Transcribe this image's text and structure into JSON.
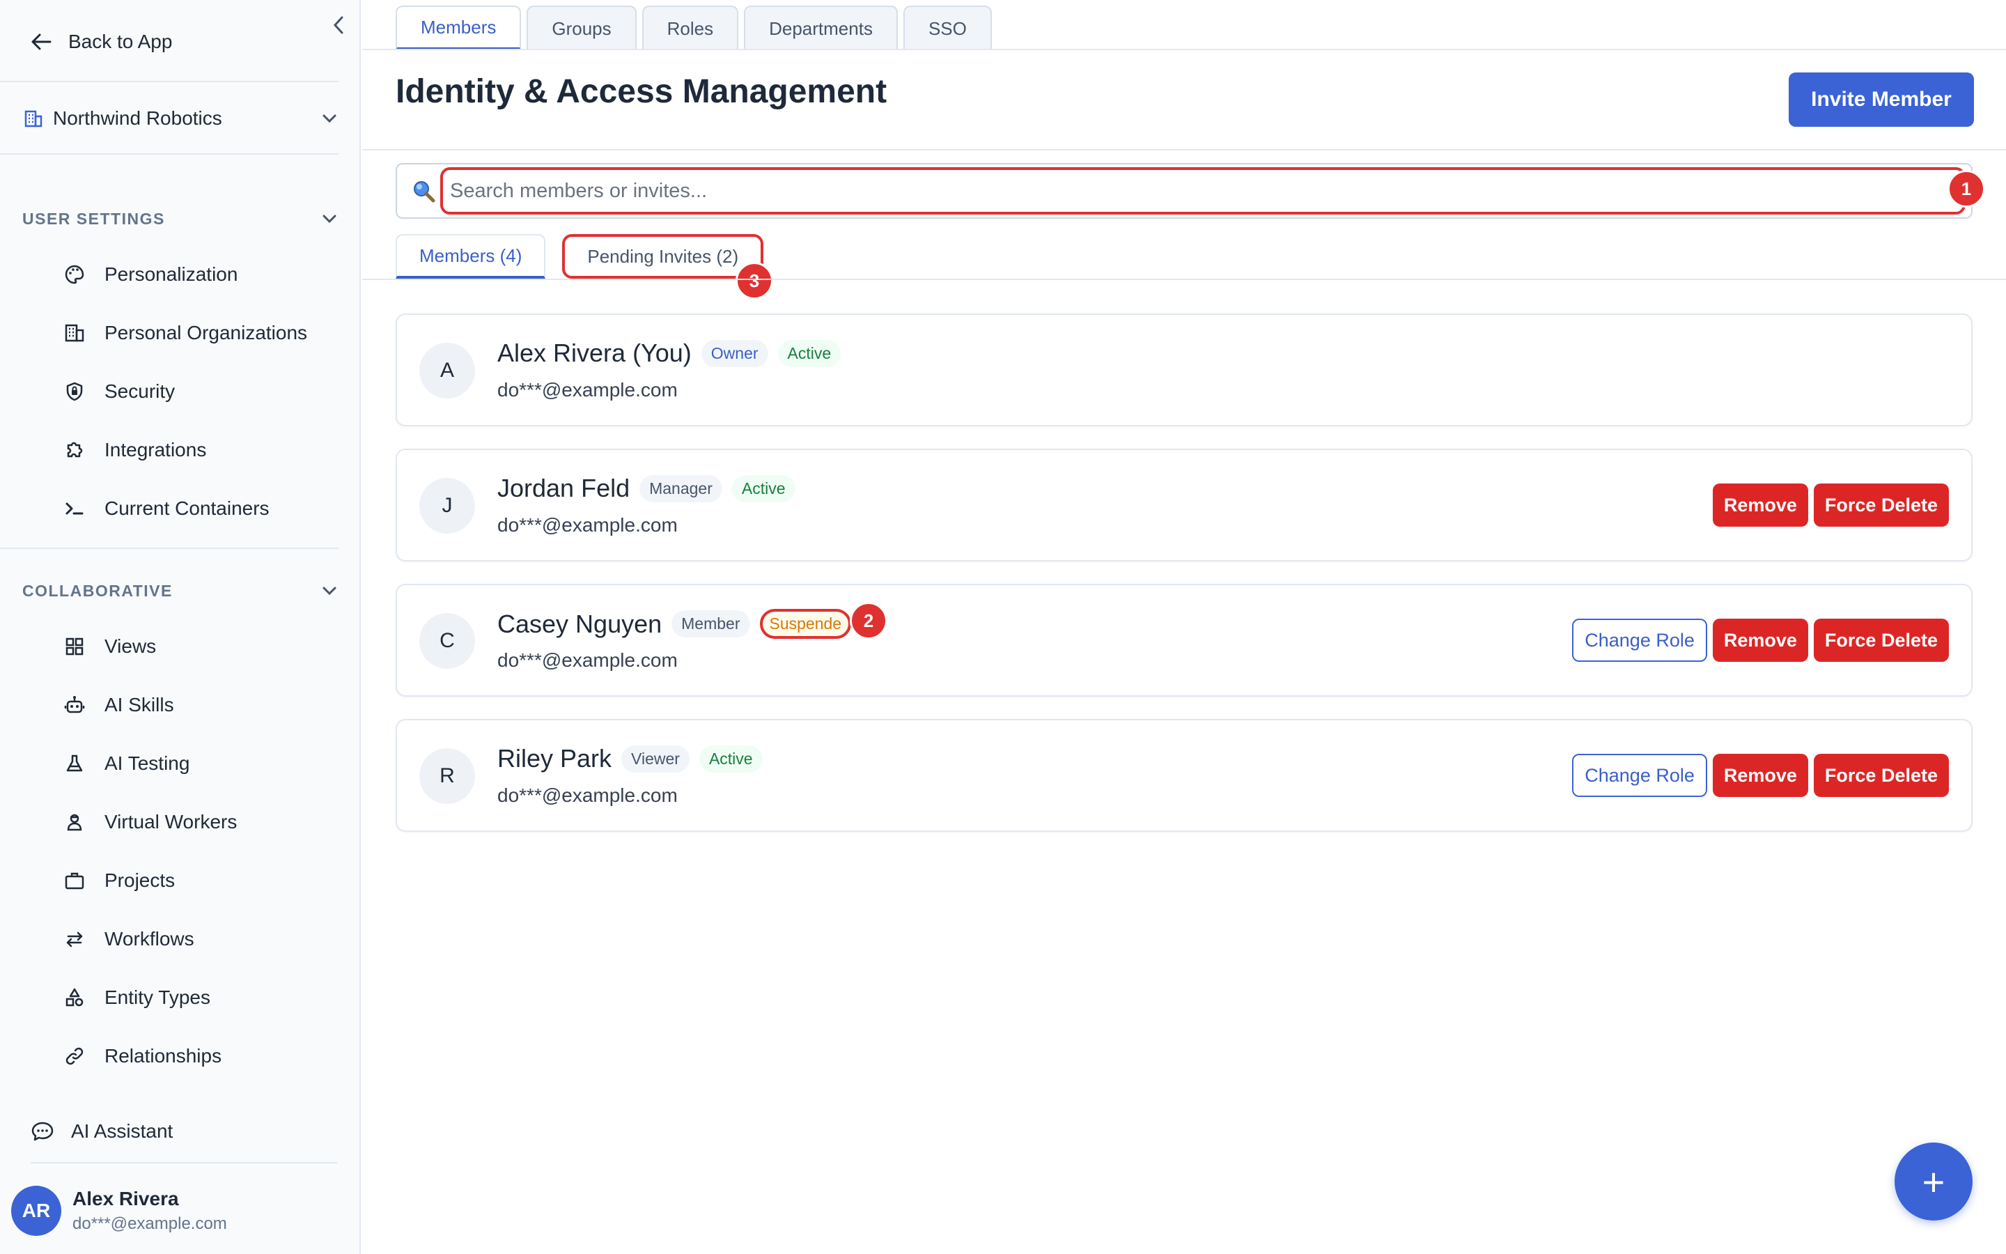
{
  "sidebar": {
    "back_label": "Back to App",
    "org_name": "Northwind Robotics",
    "user_settings_header": "USER SETTINGS",
    "user_settings_items": [
      {
        "label": "Personalization",
        "icon": "palette-icon"
      },
      {
        "label": "Personal Organizations",
        "icon": "building-icon"
      },
      {
        "label": "Security",
        "icon": "shield-icon"
      },
      {
        "label": "Integrations",
        "icon": "puzzle-icon"
      },
      {
        "label": "Current Containers",
        "icon": "terminal-icon"
      }
    ],
    "collaborative_header": "COLLABORATIVE",
    "collaborative_items": [
      {
        "label": "Views",
        "icon": "grid-icon"
      },
      {
        "label": "AI Skills",
        "icon": "robot-icon"
      },
      {
        "label": "AI Testing",
        "icon": "flask-icon"
      },
      {
        "label": "Virtual Workers",
        "icon": "worker-icon"
      },
      {
        "label": "Projects",
        "icon": "briefcase-icon"
      },
      {
        "label": "Workflows",
        "icon": "arrows-icon"
      },
      {
        "label": "Entity Types",
        "icon": "shapes-icon"
      },
      {
        "label": "Relationships",
        "icon": "link-icon"
      }
    ],
    "ai_assistant_label": "AI Assistant",
    "user": {
      "initials": "AR",
      "name": "Alex Rivera",
      "email": "do***@example.com"
    }
  },
  "main": {
    "top_tabs": [
      "Members",
      "Groups",
      "Roles",
      "Departments",
      "SSO"
    ],
    "title": "Identity & Access Management",
    "invite_label": "Invite Member",
    "search_placeholder": "Search members or invites...",
    "sub_tabs": [
      "Members (4)",
      "Pending Invites (2)"
    ],
    "annotations": [
      "1",
      "2",
      "3"
    ],
    "members": [
      {
        "initial": "A",
        "name": "Alex Rivera (You)",
        "role": "Owner",
        "status": "Active",
        "email": "do***@example.com"
      },
      {
        "initial": "J",
        "name": "Jordan Feld",
        "role": "Manager",
        "status": "Active",
        "email": "do***@example.com"
      },
      {
        "initial": "C",
        "name": "Casey Nguyen",
        "role": "Member",
        "status": "Suspende",
        "email": "do***@example.com"
      },
      {
        "initial": "R",
        "name": "Riley Park",
        "role": "Viewer",
        "status": "Active",
        "email": "do***@example.com"
      }
    ],
    "actions": {
      "change_role": "Change Role",
      "remove": "Remove",
      "force_delete": "Force Delete"
    },
    "fab_label": "+"
  },
  "colors": {
    "accent": "#3b63d6",
    "danger": "#dc2626",
    "active": "#15803d",
    "suspended": "#d97706",
    "annotation": "#e03131"
  }
}
